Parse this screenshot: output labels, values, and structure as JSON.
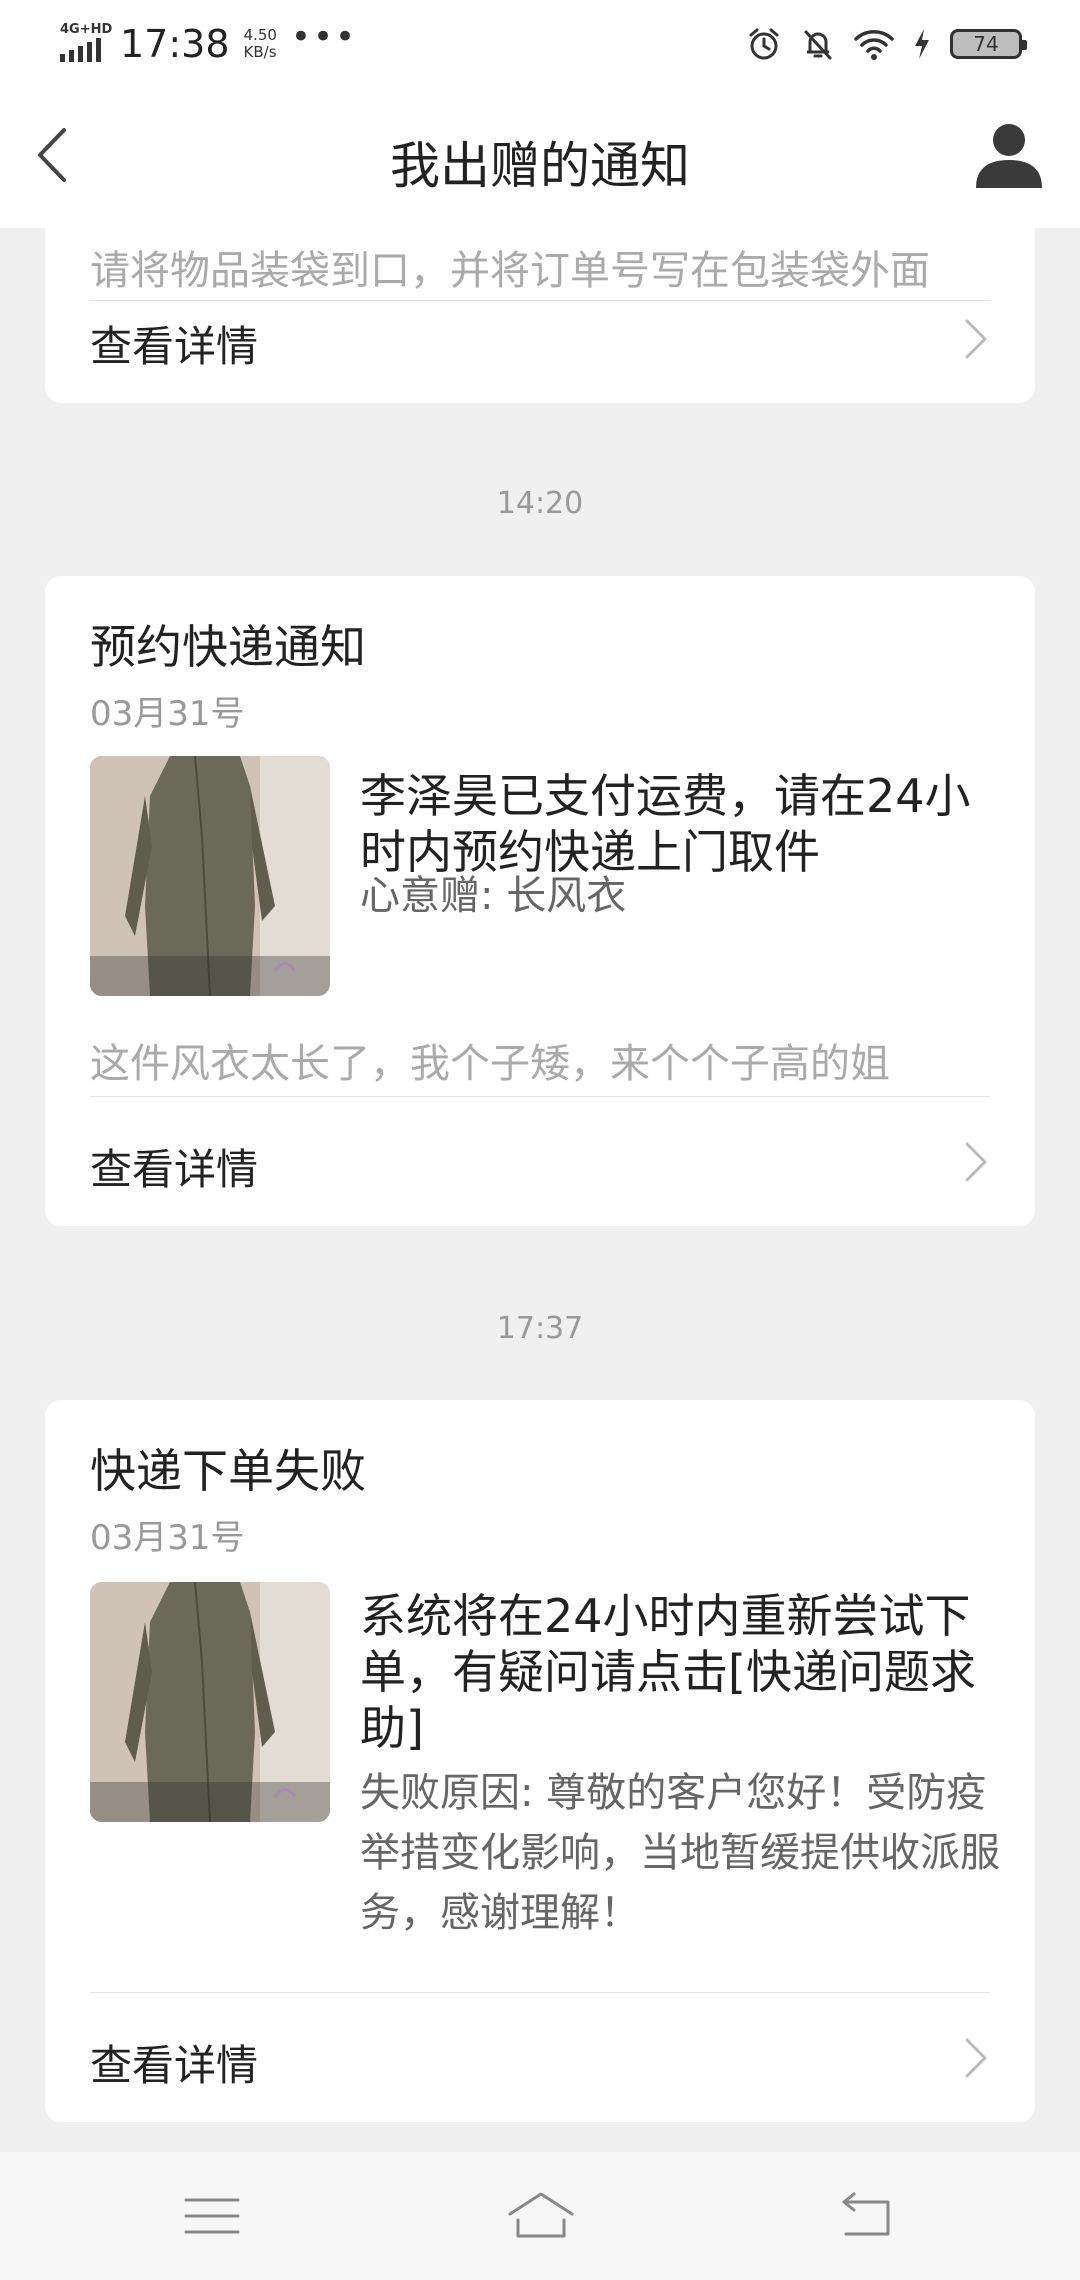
{
  "status_bar": {
    "network": "4G+HD",
    "time": "17:38",
    "speed_value": "4.50",
    "speed_unit": "KB/s",
    "more": "•••",
    "battery": "74"
  },
  "header": {
    "title": "我出赠的通知"
  },
  "top_card": {
    "cut_text": "请将物品装袋到口，并将订单号写在包装袋外面",
    "detail_label": "查看详情"
  },
  "notifications": [
    {
      "time_label": "14:20",
      "title": "预约快递通知",
      "date": "03月31号",
      "description": "李泽昊已支付运费，请在24小时内预约快递上门取件",
      "sub": "心意赠: 长风衣",
      "preview": "这件风衣太长了，我个子矮，来个个子高的姐",
      "detail_label": "查看详情"
    },
    {
      "time_label": "17:37",
      "title": "快递下单失败",
      "date": "03月31号",
      "description": "系统将在24小时内重新尝试下单，有疑问请点击[快递问题求助]",
      "sub": "失败原因: 尊敬的客户您好！受防疫举措变化影响，当地暂缓提供收派服务，感谢理解！",
      "detail_label": "查看详情"
    }
  ],
  "colors": {
    "background": "#f0f0f0",
    "card": "#ffffff",
    "secondary_text": "#999999"
  }
}
